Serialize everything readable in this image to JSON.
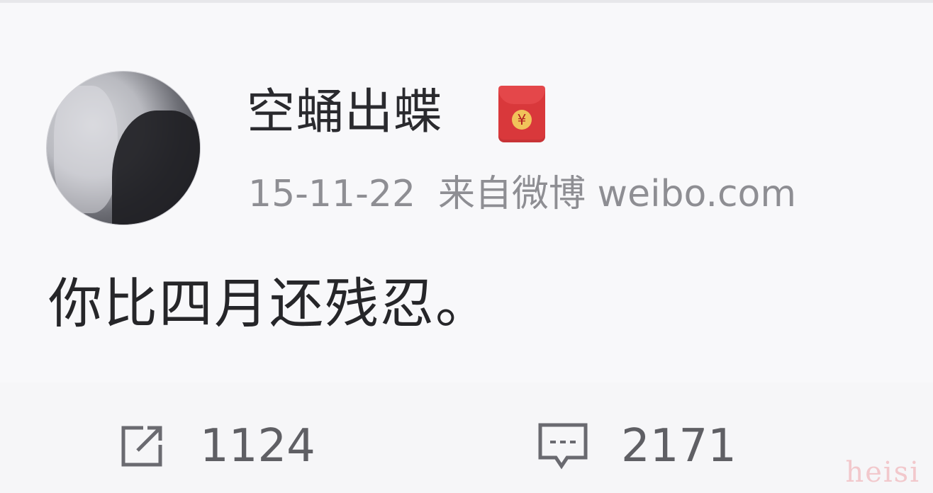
{
  "post": {
    "username": "空蛹出蝶",
    "badge_icon": "red-packet-icon",
    "badge_glyph": "¥",
    "date": "15-11-22",
    "source": "来自微博 weibo.com",
    "text": "你比四月还残忍。"
  },
  "actions": {
    "repost": {
      "icon": "share-icon",
      "count": "1124"
    },
    "comment": {
      "icon": "comment-icon",
      "count": "2171"
    }
  },
  "watermark": "heisi",
  "colors": {
    "badge": "#d9383b",
    "watermark": "#f2c8cc"
  }
}
